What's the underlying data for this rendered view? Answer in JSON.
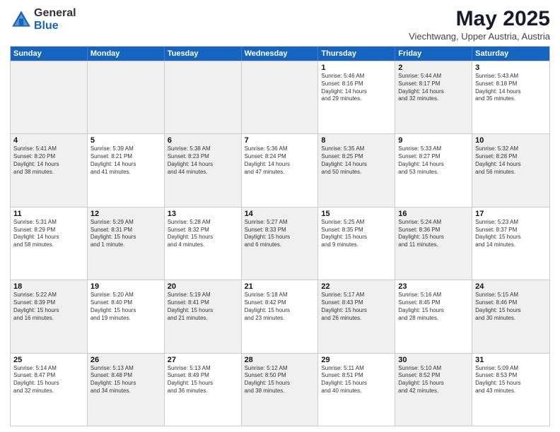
{
  "logo": {
    "general": "General",
    "blue": "Blue"
  },
  "title": "May 2025",
  "location": "Viechtwang, Upper Austria, Austria",
  "headers": [
    "Sunday",
    "Monday",
    "Tuesday",
    "Wednesday",
    "Thursday",
    "Friday",
    "Saturday"
  ],
  "weeks": [
    [
      {
        "day": "",
        "info": "",
        "shaded": true
      },
      {
        "day": "",
        "info": "",
        "shaded": true
      },
      {
        "day": "",
        "info": "",
        "shaded": true
      },
      {
        "day": "",
        "info": "",
        "shaded": true
      },
      {
        "day": "1",
        "info": "Sunrise: 5:46 AM\nSunset: 8:16 PM\nDaylight: 14 hours\nand 29 minutes.",
        "shaded": false
      },
      {
        "day": "2",
        "info": "Sunrise: 5:44 AM\nSunset: 8:17 PM\nDaylight: 14 hours\nand 32 minutes.",
        "shaded": true
      },
      {
        "day": "3",
        "info": "Sunrise: 5:43 AM\nSunset: 8:18 PM\nDaylight: 14 hours\nand 35 minutes.",
        "shaded": false
      }
    ],
    [
      {
        "day": "4",
        "info": "Sunrise: 5:41 AM\nSunset: 8:20 PM\nDaylight: 14 hours\nand 38 minutes.",
        "shaded": true
      },
      {
        "day": "5",
        "info": "Sunrise: 5:39 AM\nSunset: 8:21 PM\nDaylight: 14 hours\nand 41 minutes.",
        "shaded": false
      },
      {
        "day": "6",
        "info": "Sunrise: 5:38 AM\nSunset: 8:23 PM\nDaylight: 14 hours\nand 44 minutes.",
        "shaded": true
      },
      {
        "day": "7",
        "info": "Sunrise: 5:36 AM\nSunset: 8:24 PM\nDaylight: 14 hours\nand 47 minutes.",
        "shaded": false
      },
      {
        "day": "8",
        "info": "Sunrise: 5:35 AM\nSunset: 8:25 PM\nDaylight: 14 hours\nand 50 minutes.",
        "shaded": true
      },
      {
        "day": "9",
        "info": "Sunrise: 5:33 AM\nSunset: 8:27 PM\nDaylight: 14 hours\nand 53 minutes.",
        "shaded": false
      },
      {
        "day": "10",
        "info": "Sunrise: 5:32 AM\nSunset: 8:28 PM\nDaylight: 14 hours\nand 56 minutes.",
        "shaded": true
      }
    ],
    [
      {
        "day": "11",
        "info": "Sunrise: 5:31 AM\nSunset: 8:29 PM\nDaylight: 14 hours\nand 58 minutes.",
        "shaded": false
      },
      {
        "day": "12",
        "info": "Sunrise: 5:29 AM\nSunset: 8:31 PM\nDaylight: 15 hours\nand 1 minute.",
        "shaded": true
      },
      {
        "day": "13",
        "info": "Sunrise: 5:28 AM\nSunset: 8:32 PM\nDaylight: 15 hours\nand 4 minutes.",
        "shaded": false
      },
      {
        "day": "14",
        "info": "Sunrise: 5:27 AM\nSunset: 8:33 PM\nDaylight: 15 hours\nand 6 minutes.",
        "shaded": true
      },
      {
        "day": "15",
        "info": "Sunrise: 5:25 AM\nSunset: 8:35 PM\nDaylight: 15 hours\nand 9 minutes.",
        "shaded": false
      },
      {
        "day": "16",
        "info": "Sunrise: 5:24 AM\nSunset: 8:36 PM\nDaylight: 15 hours\nand 11 minutes.",
        "shaded": true
      },
      {
        "day": "17",
        "info": "Sunrise: 5:23 AM\nSunset: 8:37 PM\nDaylight: 15 hours\nand 14 minutes.",
        "shaded": false
      }
    ],
    [
      {
        "day": "18",
        "info": "Sunrise: 5:22 AM\nSunset: 8:39 PM\nDaylight: 15 hours\nand 16 minutes.",
        "shaded": true
      },
      {
        "day": "19",
        "info": "Sunrise: 5:20 AM\nSunset: 8:40 PM\nDaylight: 15 hours\nand 19 minutes.",
        "shaded": false
      },
      {
        "day": "20",
        "info": "Sunrise: 5:19 AM\nSunset: 8:41 PM\nDaylight: 15 hours\nand 21 minutes.",
        "shaded": true
      },
      {
        "day": "21",
        "info": "Sunrise: 5:18 AM\nSunset: 8:42 PM\nDaylight: 15 hours\nand 23 minutes.",
        "shaded": false
      },
      {
        "day": "22",
        "info": "Sunrise: 5:17 AM\nSunset: 8:43 PM\nDaylight: 15 hours\nand 26 minutes.",
        "shaded": true
      },
      {
        "day": "23",
        "info": "Sunrise: 5:16 AM\nSunset: 8:45 PM\nDaylight: 15 hours\nand 28 minutes.",
        "shaded": false
      },
      {
        "day": "24",
        "info": "Sunrise: 5:15 AM\nSunset: 8:46 PM\nDaylight: 15 hours\nand 30 minutes.",
        "shaded": true
      }
    ],
    [
      {
        "day": "25",
        "info": "Sunrise: 5:14 AM\nSunset: 8:47 PM\nDaylight: 15 hours\nand 32 minutes.",
        "shaded": false
      },
      {
        "day": "26",
        "info": "Sunrise: 5:13 AM\nSunset: 8:48 PM\nDaylight: 15 hours\nand 34 minutes.",
        "shaded": true
      },
      {
        "day": "27",
        "info": "Sunrise: 5:13 AM\nSunset: 8:49 PM\nDaylight: 15 hours\nand 36 minutes.",
        "shaded": false
      },
      {
        "day": "28",
        "info": "Sunrise: 5:12 AM\nSunset: 8:50 PM\nDaylight: 15 hours\nand 38 minutes.",
        "shaded": true
      },
      {
        "day": "29",
        "info": "Sunrise: 5:11 AM\nSunset: 8:51 PM\nDaylight: 15 hours\nand 40 minutes.",
        "shaded": false
      },
      {
        "day": "30",
        "info": "Sunrise: 5:10 AM\nSunset: 8:52 PM\nDaylight: 15 hours\nand 42 minutes.",
        "shaded": true
      },
      {
        "day": "31",
        "info": "Sunrise: 5:09 AM\nSunset: 8:53 PM\nDaylight: 15 hours\nand 43 minutes.",
        "shaded": false
      }
    ]
  ]
}
